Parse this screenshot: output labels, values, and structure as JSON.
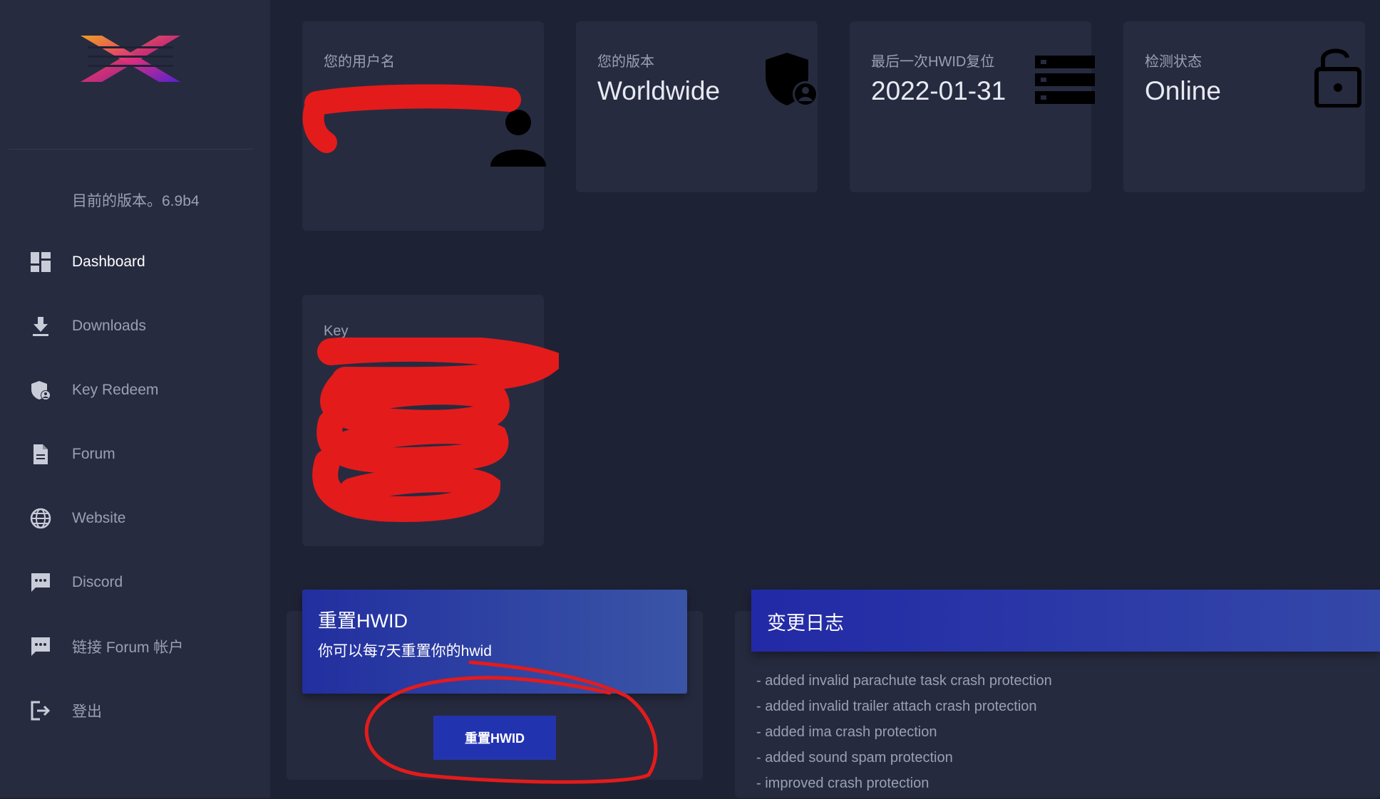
{
  "sidebar": {
    "version_text": "目前的版本。6.9b4",
    "items": [
      {
        "label": "Dashboard",
        "icon": "dashboard-icon"
      },
      {
        "label": "Downloads",
        "icon": "download-icon"
      },
      {
        "label": "Key Redeem",
        "icon": "shield-user-icon"
      },
      {
        "label": "Forum",
        "icon": "document-icon"
      },
      {
        "label": "Website",
        "icon": "globe-icon"
      },
      {
        "label": "Discord",
        "icon": "chat-icon"
      },
      {
        "label": "链接 Forum 帐户",
        "icon": "chat-icon"
      },
      {
        "label": "登出",
        "icon": "logout-icon"
      }
    ]
  },
  "cards": {
    "username": {
      "caption": "您的用户名",
      "icon": "user-icon"
    },
    "version": {
      "caption": "您的版本",
      "value": "Worldwide",
      "icon": "shield-user-icon"
    },
    "hwid_reset": {
      "caption": "最后一次HWID复位",
      "value": "2022-01-31",
      "icon": "server-icon"
    },
    "detection": {
      "caption": "检测状态",
      "value": "Online",
      "icon": "unlock-icon"
    },
    "key": {
      "caption": "Key"
    }
  },
  "reset_panel": {
    "title": "重置HWID",
    "subtitle": "你可以每7天重置你的hwid",
    "button_label": "重置HWID"
  },
  "changelog": {
    "title": "变更日志",
    "entries": [
      "- added invalid parachute task crash protection",
      "- added invalid trailer attach crash protection",
      "- added ima crash protection",
      "- added sound spam protection",
      "- improved crash protection"
    ]
  },
  "colors": {
    "background": "#1e2235",
    "sidebar": "#272b3f",
    "card": "#272b40",
    "accent": "#2233b0",
    "annotation_red": "#e41b1b"
  }
}
